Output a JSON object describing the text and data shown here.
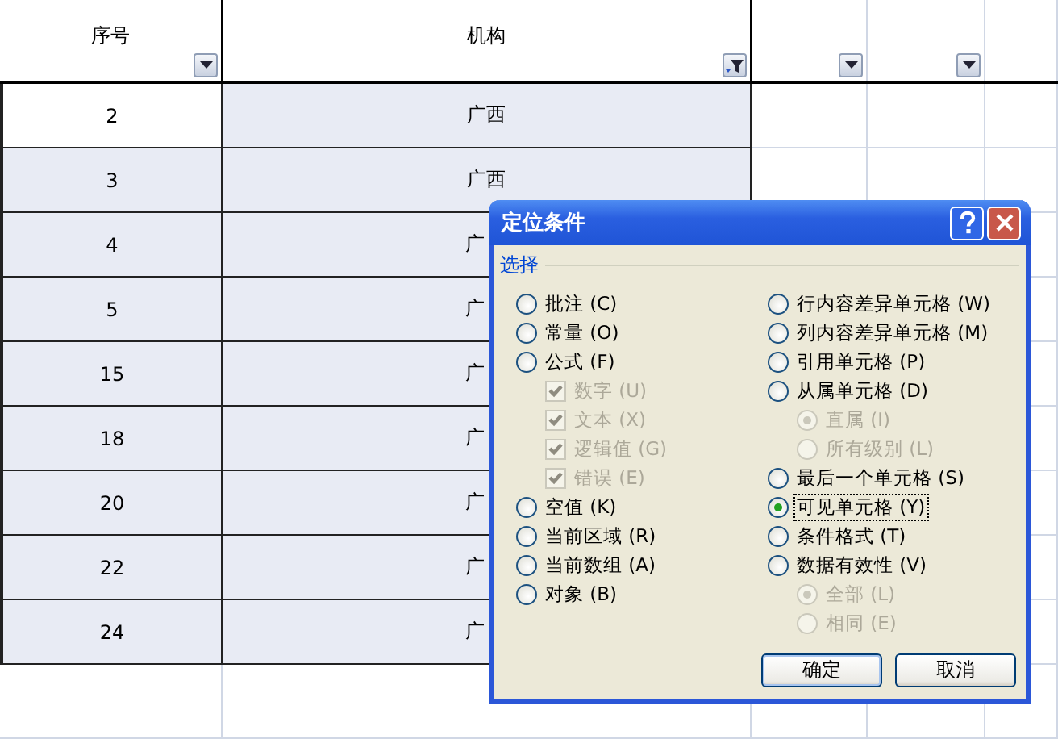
{
  "table": {
    "columns": [
      {
        "header": "序号",
        "filtered": false
      },
      {
        "header": "机构",
        "filtered": true
      },
      {
        "filtered": false
      },
      {
        "filtered": false
      }
    ],
    "rows": [
      {
        "seq": "2",
        "seq_selected": false,
        "org": "广西",
        "org_selected": true,
        "org_cut": false
      },
      {
        "seq": "3",
        "seq_selected": true,
        "org": "广西",
        "org_selected": true,
        "org_cut": false
      },
      {
        "seq": "4",
        "seq_selected": true,
        "org": "广",
        "org_selected": true,
        "org_cut": true
      },
      {
        "seq": "5",
        "seq_selected": true,
        "org": "广",
        "org_selected": true,
        "org_cut": true
      },
      {
        "seq": "15",
        "seq_selected": true,
        "org": "广",
        "org_selected": true,
        "org_cut": true
      },
      {
        "seq": "18",
        "seq_selected": true,
        "org": "广",
        "org_selected": true,
        "org_cut": true
      },
      {
        "seq": "20",
        "seq_selected": true,
        "org": "广",
        "org_selected": true,
        "org_cut": true
      },
      {
        "seq": "22",
        "seq_selected": true,
        "org": "广",
        "org_selected": true,
        "org_cut": true
      },
      {
        "seq": "24",
        "seq_selected": true,
        "org": "广",
        "org_selected": true,
        "org_cut": true
      }
    ]
  },
  "dialog": {
    "title": "定位条件",
    "group": "选择",
    "left_options": [
      {
        "label": "批注 (C)",
        "selected": false,
        "focused": false
      },
      {
        "label": "常量 (O)",
        "selected": false,
        "focused": false
      },
      {
        "label": "公式 (F)",
        "selected": false,
        "focused": false,
        "children": [
          {
            "kind": "checkbox",
            "label": "数字 (U)",
            "checked": true,
            "disabled": true
          },
          {
            "kind": "checkbox",
            "label": "文本 (X)",
            "checked": true,
            "disabled": true
          },
          {
            "kind": "checkbox",
            "label": "逻辑值 (G)",
            "checked": true,
            "disabled": true
          },
          {
            "kind": "checkbox",
            "label": "错误 (E)",
            "checked": true,
            "disabled": true
          }
        ]
      },
      {
        "label": "空值 (K)",
        "selected": false,
        "focused": false
      },
      {
        "label": "当前区域 (R)",
        "selected": false,
        "focused": false
      },
      {
        "label": "当前数组 (A)",
        "selected": false,
        "focused": false
      },
      {
        "label": "对象 (B)",
        "selected": false,
        "focused": false
      }
    ],
    "right_options": [
      {
        "label": "行内容差异单元格 (W)",
        "selected": false,
        "focused": false
      },
      {
        "label": "列内容差异单元格 (M)",
        "selected": false,
        "focused": false
      },
      {
        "label": "引用单元格 (P)",
        "selected": false,
        "focused": false
      },
      {
        "label": "从属单元格 (D)",
        "selected": false,
        "focused": false,
        "children": [
          {
            "kind": "radio",
            "label": "直属 (I)",
            "checked": true,
            "disabled": true
          },
          {
            "kind": "radio",
            "label": "所有级别 (L)",
            "checked": false,
            "disabled": true
          }
        ]
      },
      {
        "label": "最后一个单元格 (S)",
        "selected": false,
        "focused": false
      },
      {
        "label": "可见单元格 (Y)",
        "selected": true,
        "focused": true
      },
      {
        "label": "条件格式 (T)",
        "selected": false,
        "focused": false
      },
      {
        "label": "数据有效性 (V)",
        "selected": false,
        "focused": false,
        "children": [
          {
            "kind": "radio",
            "label": "全部 (L)",
            "checked": true,
            "disabled": true
          },
          {
            "kind": "radio",
            "label": "相同 (E)",
            "checked": false,
            "disabled": true
          }
        ]
      }
    ],
    "buttons": [
      "确定",
      "取消"
    ]
  }
}
